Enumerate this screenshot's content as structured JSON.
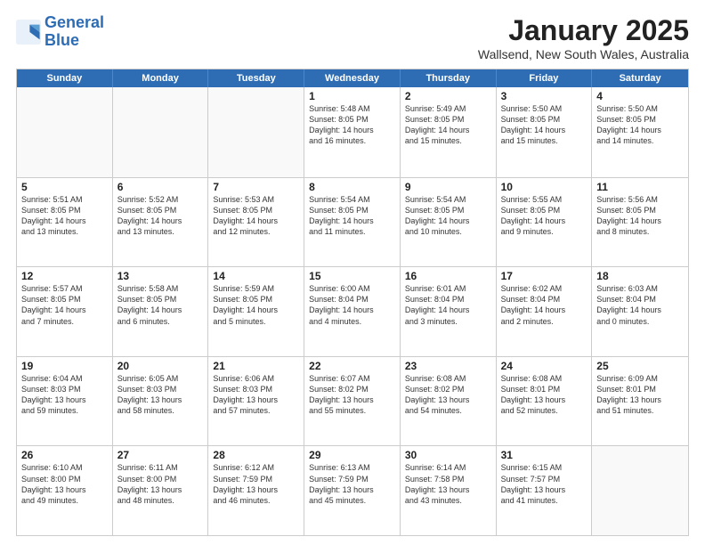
{
  "logo": {
    "line1": "General",
    "line2": "Blue"
  },
  "title": "January 2025",
  "subtitle": "Wallsend, New South Wales, Australia",
  "headers": [
    "Sunday",
    "Monday",
    "Tuesday",
    "Wednesday",
    "Thursday",
    "Friday",
    "Saturday"
  ],
  "weeks": [
    [
      {
        "day": "",
        "info": ""
      },
      {
        "day": "",
        "info": ""
      },
      {
        "day": "",
        "info": ""
      },
      {
        "day": "1",
        "info": "Sunrise: 5:48 AM\nSunset: 8:05 PM\nDaylight: 14 hours\nand 16 minutes."
      },
      {
        "day": "2",
        "info": "Sunrise: 5:49 AM\nSunset: 8:05 PM\nDaylight: 14 hours\nand 15 minutes."
      },
      {
        "day": "3",
        "info": "Sunrise: 5:50 AM\nSunset: 8:05 PM\nDaylight: 14 hours\nand 15 minutes."
      },
      {
        "day": "4",
        "info": "Sunrise: 5:50 AM\nSunset: 8:05 PM\nDaylight: 14 hours\nand 14 minutes."
      }
    ],
    [
      {
        "day": "5",
        "info": "Sunrise: 5:51 AM\nSunset: 8:05 PM\nDaylight: 14 hours\nand 13 minutes."
      },
      {
        "day": "6",
        "info": "Sunrise: 5:52 AM\nSunset: 8:05 PM\nDaylight: 14 hours\nand 13 minutes."
      },
      {
        "day": "7",
        "info": "Sunrise: 5:53 AM\nSunset: 8:05 PM\nDaylight: 14 hours\nand 12 minutes."
      },
      {
        "day": "8",
        "info": "Sunrise: 5:54 AM\nSunset: 8:05 PM\nDaylight: 14 hours\nand 11 minutes."
      },
      {
        "day": "9",
        "info": "Sunrise: 5:54 AM\nSunset: 8:05 PM\nDaylight: 14 hours\nand 10 minutes."
      },
      {
        "day": "10",
        "info": "Sunrise: 5:55 AM\nSunset: 8:05 PM\nDaylight: 14 hours\nand 9 minutes."
      },
      {
        "day": "11",
        "info": "Sunrise: 5:56 AM\nSunset: 8:05 PM\nDaylight: 14 hours\nand 8 minutes."
      }
    ],
    [
      {
        "day": "12",
        "info": "Sunrise: 5:57 AM\nSunset: 8:05 PM\nDaylight: 14 hours\nand 7 minutes."
      },
      {
        "day": "13",
        "info": "Sunrise: 5:58 AM\nSunset: 8:05 PM\nDaylight: 14 hours\nand 6 minutes."
      },
      {
        "day": "14",
        "info": "Sunrise: 5:59 AM\nSunset: 8:05 PM\nDaylight: 14 hours\nand 5 minutes."
      },
      {
        "day": "15",
        "info": "Sunrise: 6:00 AM\nSunset: 8:04 PM\nDaylight: 14 hours\nand 4 minutes."
      },
      {
        "day": "16",
        "info": "Sunrise: 6:01 AM\nSunset: 8:04 PM\nDaylight: 14 hours\nand 3 minutes."
      },
      {
        "day": "17",
        "info": "Sunrise: 6:02 AM\nSunset: 8:04 PM\nDaylight: 14 hours\nand 2 minutes."
      },
      {
        "day": "18",
        "info": "Sunrise: 6:03 AM\nSunset: 8:04 PM\nDaylight: 14 hours\nand 0 minutes."
      }
    ],
    [
      {
        "day": "19",
        "info": "Sunrise: 6:04 AM\nSunset: 8:03 PM\nDaylight: 13 hours\nand 59 minutes."
      },
      {
        "day": "20",
        "info": "Sunrise: 6:05 AM\nSunset: 8:03 PM\nDaylight: 13 hours\nand 58 minutes."
      },
      {
        "day": "21",
        "info": "Sunrise: 6:06 AM\nSunset: 8:03 PM\nDaylight: 13 hours\nand 57 minutes."
      },
      {
        "day": "22",
        "info": "Sunrise: 6:07 AM\nSunset: 8:02 PM\nDaylight: 13 hours\nand 55 minutes."
      },
      {
        "day": "23",
        "info": "Sunrise: 6:08 AM\nSunset: 8:02 PM\nDaylight: 13 hours\nand 54 minutes."
      },
      {
        "day": "24",
        "info": "Sunrise: 6:08 AM\nSunset: 8:01 PM\nDaylight: 13 hours\nand 52 minutes."
      },
      {
        "day": "25",
        "info": "Sunrise: 6:09 AM\nSunset: 8:01 PM\nDaylight: 13 hours\nand 51 minutes."
      }
    ],
    [
      {
        "day": "26",
        "info": "Sunrise: 6:10 AM\nSunset: 8:00 PM\nDaylight: 13 hours\nand 49 minutes."
      },
      {
        "day": "27",
        "info": "Sunrise: 6:11 AM\nSunset: 8:00 PM\nDaylight: 13 hours\nand 48 minutes."
      },
      {
        "day": "28",
        "info": "Sunrise: 6:12 AM\nSunset: 7:59 PM\nDaylight: 13 hours\nand 46 minutes."
      },
      {
        "day": "29",
        "info": "Sunrise: 6:13 AM\nSunset: 7:59 PM\nDaylight: 13 hours\nand 45 minutes."
      },
      {
        "day": "30",
        "info": "Sunrise: 6:14 AM\nSunset: 7:58 PM\nDaylight: 13 hours\nand 43 minutes."
      },
      {
        "day": "31",
        "info": "Sunrise: 6:15 AM\nSunset: 7:57 PM\nDaylight: 13 hours\nand 41 minutes."
      },
      {
        "day": "",
        "info": ""
      }
    ]
  ]
}
